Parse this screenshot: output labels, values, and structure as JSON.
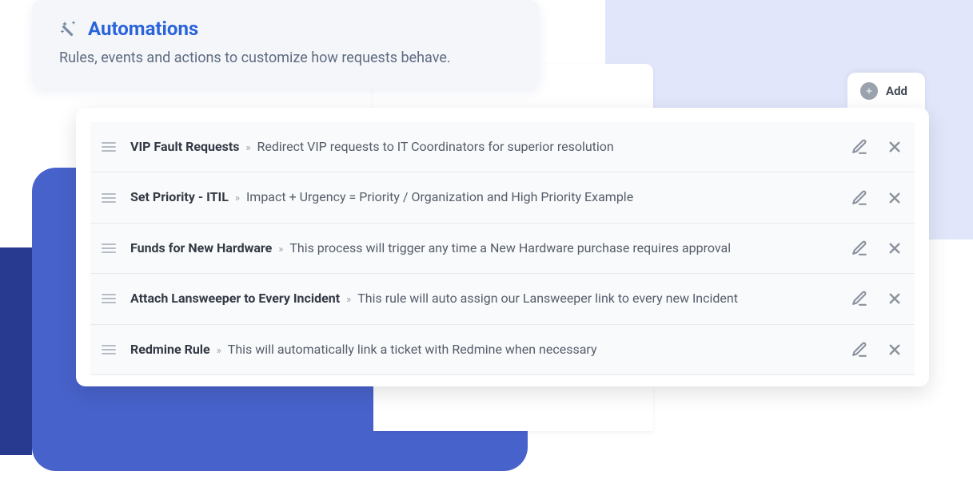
{
  "header": {
    "title": "Automations",
    "subtitle": "Rules, events and actions to customize how requests behave."
  },
  "add_button": {
    "label": "Add"
  },
  "separator": "»",
  "rules": [
    {
      "title": "VIP Fault Requests",
      "description": "Redirect VIP requests to IT Coordinators for superior resolution"
    },
    {
      "title": "Set Priority - ITIL",
      "description": "Impact + Urgency = Priority / Organization and High Priority Example"
    },
    {
      "title": "Funds for New Hardware",
      "description": "This process will trigger any time a New Hardware purchase requires approval"
    },
    {
      "title": "Attach Lansweeper to Every Incident",
      "description": "This rule will auto assign our Lansweeper link to every new Incident"
    },
    {
      "title": "Redmine Rule",
      "description": "This will automatically link a ticket with Redmine when necessary"
    }
  ]
}
